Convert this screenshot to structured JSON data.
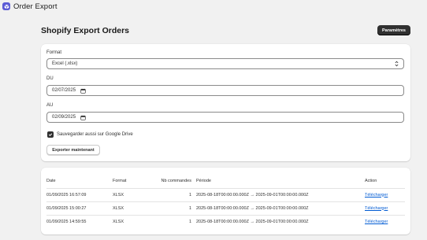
{
  "app": {
    "title": "Order Export",
    "icon": "box-icon",
    "accent": "#5b5bd6"
  },
  "page": {
    "title": "Shopify Export Orders",
    "settings_button": "Paramètres"
  },
  "form": {
    "format_label": "Format",
    "format_value": "Excel (.xlsx)",
    "du_label": "DU",
    "du_value": "02/07/2025",
    "au_label": "AU",
    "au_value": "02/09/2025",
    "drive_checkbox_label": "Sauvegarder aussi sur Google Drive",
    "drive_checked": true,
    "export_button": "Exporter maintenant"
  },
  "table": {
    "headers": [
      "Date",
      "Format",
      "Nb commandes",
      "Période",
      "Action"
    ],
    "rows": [
      {
        "date": "01/09/2025 16:57:09",
        "format": "XLSX",
        "count": "1",
        "period": "2025-08-18T00:00:00.000Z → 2025-09-01T00:00:00.000Z",
        "action": "Télécharger"
      },
      {
        "date": "01/09/2025 15:00:27",
        "format": "XLSX",
        "count": "1",
        "period": "2025-08-18T00:00:00.000Z → 2025-09-01T00:00:00.000Z",
        "action": "Télécharger"
      },
      {
        "date": "01/09/2025 14:59:55",
        "format": "XLSX",
        "count": "1",
        "period": "2025-08-18T00:00:00.000Z → 2025-09-01T00:00:00.000Z",
        "action": "Télécharger"
      }
    ]
  }
}
